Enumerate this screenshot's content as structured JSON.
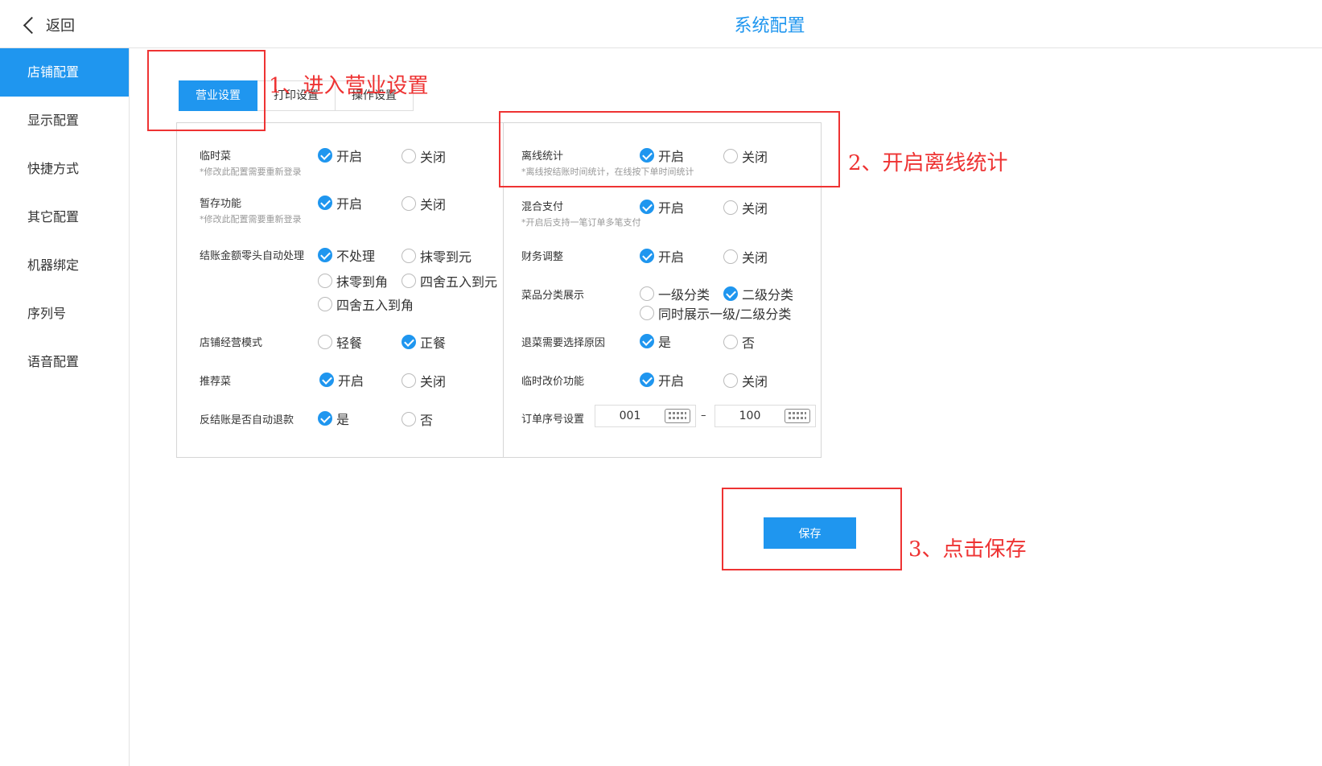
{
  "header": {
    "back_label": "返回",
    "title": "系统配置"
  },
  "sidebar": {
    "items": [
      {
        "label": "店铺配置"
      },
      {
        "label": "显示配置"
      },
      {
        "label": "快捷方式"
      },
      {
        "label": "其它配置"
      },
      {
        "label": "机器绑定"
      },
      {
        "label": "序列号"
      },
      {
        "label": "语音配置"
      }
    ],
    "active": "店铺配置"
  },
  "tabs": [
    {
      "label": "营业设置"
    },
    {
      "label": "打印设置"
    },
    {
      "label": "操作设置"
    }
  ],
  "left": {
    "temp_dish": {
      "label": "临时菜",
      "hint": "*修改此配置需要重新登录",
      "on": "开启",
      "off": "关闭",
      "selected": "on"
    },
    "hold": {
      "label": "暂存功能",
      "hint": "*修改此配置需要重新登录",
      "on": "开启",
      "off": "关闭",
      "selected": "on"
    },
    "rounding": {
      "label": "结账金额零头自动处理",
      "opts": [
        "不处理",
        "抹零到元",
        "抹零到角",
        "四舍五入到元",
        "四舍五入到角"
      ],
      "selected": 0
    },
    "mode": {
      "label": "店铺经营模式",
      "opts": [
        "轻餐",
        "正餐"
      ],
      "selected": 1
    },
    "recommend": {
      "label": "推荐菜",
      "on": "开启",
      "off": "关闭",
      "selected": "on"
    },
    "refund": {
      "label": "反结账是否自动退款",
      "on": "是",
      "off": "否",
      "selected": "on"
    }
  },
  "right": {
    "offline": {
      "label": "离线统计",
      "hint": "*离线按结账时间统计，在线按下单时间统计",
      "on": "开启",
      "off": "关闭",
      "selected": "on"
    },
    "mixed": {
      "label": "混合支付",
      "hint": "*开启后支持一笔订单多笔支付",
      "on": "开启",
      "off": "关闭",
      "selected": "on"
    },
    "finance": {
      "label": "财务调整",
      "on": "开启",
      "off": "关闭",
      "selected": "on"
    },
    "category": {
      "label": "菜品分类展示",
      "opts": [
        "一级分类",
        "二级分类",
        "同时展示一级/二级分类"
      ],
      "selected": 1
    },
    "reason": {
      "label": "退菜需要选择原因",
      "on": "是",
      "off": "否",
      "selected": "on"
    },
    "price": {
      "label": "临时改价功能",
      "on": "开启",
      "off": "关闭",
      "selected": "on"
    },
    "order_seq": {
      "label": "订单序号设置",
      "from": "001",
      "to": "100",
      "dash": "–"
    }
  },
  "save_label": "保存",
  "annotations": {
    "step1": "1、进入营业设置",
    "step2": "2、开启离线统计",
    "step3": "3、点击保存",
    "color": "#e33333"
  },
  "colors": {
    "accent": "#1f96ef"
  }
}
